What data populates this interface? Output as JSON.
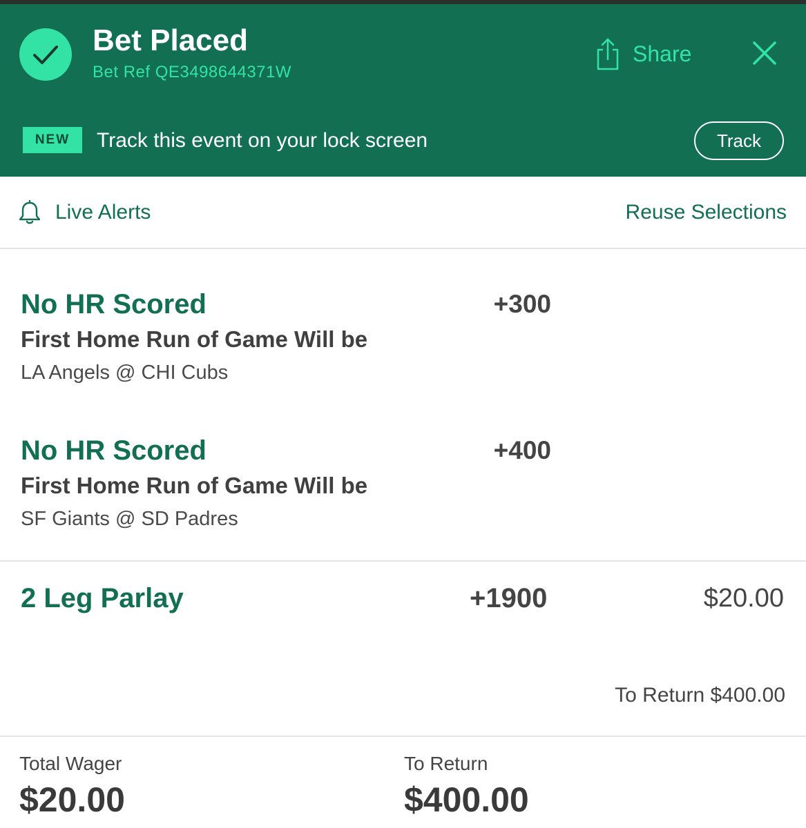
{
  "colors": {
    "brand": "#126f51",
    "accent": "#33e3a6",
    "text_dark": "#444444"
  },
  "header": {
    "status_icon": "checkmark-circle-icon",
    "title": "Bet Placed",
    "bet_ref": "Bet Ref QE3498644371W",
    "share_icon": "share-icon",
    "share_label": "Share",
    "close_icon": "close-icon"
  },
  "lockscreen_banner": {
    "badge": "NEW",
    "text": "Track this event on your lock screen",
    "button_label": "Track"
  },
  "alerts_bar": {
    "bell_icon": "bell-icon",
    "live_alerts_label": "Live Alerts",
    "reuse_label": "Reuse Selections"
  },
  "selections": [
    {
      "name": "No HR Scored",
      "market": "First Home Run of Game Will be",
      "event": "LA Angels @ CHI Cubs",
      "odds": "+300"
    },
    {
      "name": "No HR Scored",
      "market": "First Home Run of Game Will be",
      "event": "SF Giants @ SD Padres",
      "odds": "+400"
    }
  ],
  "parlay": {
    "label": "2 Leg Parlay",
    "odds": "+1900",
    "stake": "$20.00",
    "to_return": "To Return $400.00"
  },
  "summary": {
    "total_wager_label": "Total Wager",
    "total_wager_value": "$20.00",
    "to_return_label": "To Return",
    "to_return_value": "$400.00"
  }
}
